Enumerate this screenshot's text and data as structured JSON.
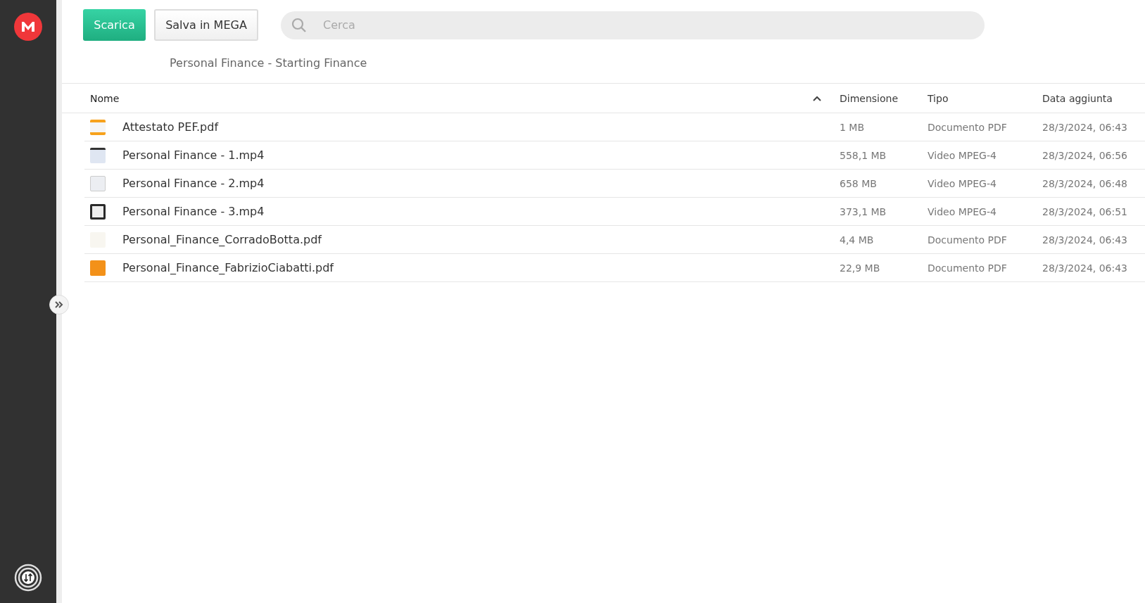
{
  "toolbar": {
    "buttons": [
      {
        "label": "Scarica",
        "kind": "primary"
      },
      {
        "label": "Salva in MEGA",
        "kind": "secondary"
      }
    ],
    "search": {
      "placeholder": "Cerca"
    }
  },
  "breadcrumb": "Personal Finance - Starting Finance",
  "table": {
    "columns": [
      {
        "label": "Nome",
        "sorted": true
      },
      {
        "label": "Dimensione",
        "sorted": false
      },
      {
        "label": "Tipo",
        "sorted": false
      },
      {
        "label": "Data aggiunta",
        "sorted": false
      }
    ],
    "rows": [
      {
        "name": "Attestato PEF.pdf",
        "size": "1 MB",
        "type": "Documento PDF",
        "date": "28/3/2024, 06:43"
      },
      {
        "name": "Personal Finance - 1.mp4",
        "size": "558,1 MB",
        "type": "Video MPEG-4",
        "date": "28/3/2024, 06:56"
      },
      {
        "name": "Personal Finance - 2.mp4",
        "size": "658 MB",
        "type": "Video MPEG-4",
        "date": "28/3/2024, 06:48"
      },
      {
        "name": "Personal Finance - 3.mp4",
        "size": "373,1 MB",
        "type": "Video MPEG-4",
        "date": "28/3/2024, 06:51"
      },
      {
        "name": "Personal_Finance_CorradoBotta.pdf",
        "size": "4,4 MB",
        "type": "Documento PDF",
        "date": "28/3/2024, 06:43"
      },
      {
        "name": "Personal_Finance_FabrizioCiabatti.pdf",
        "size": "22,9 MB",
        "type": "Documento PDF",
        "date": "28/3/2024, 06:43"
      }
    ]
  }
}
